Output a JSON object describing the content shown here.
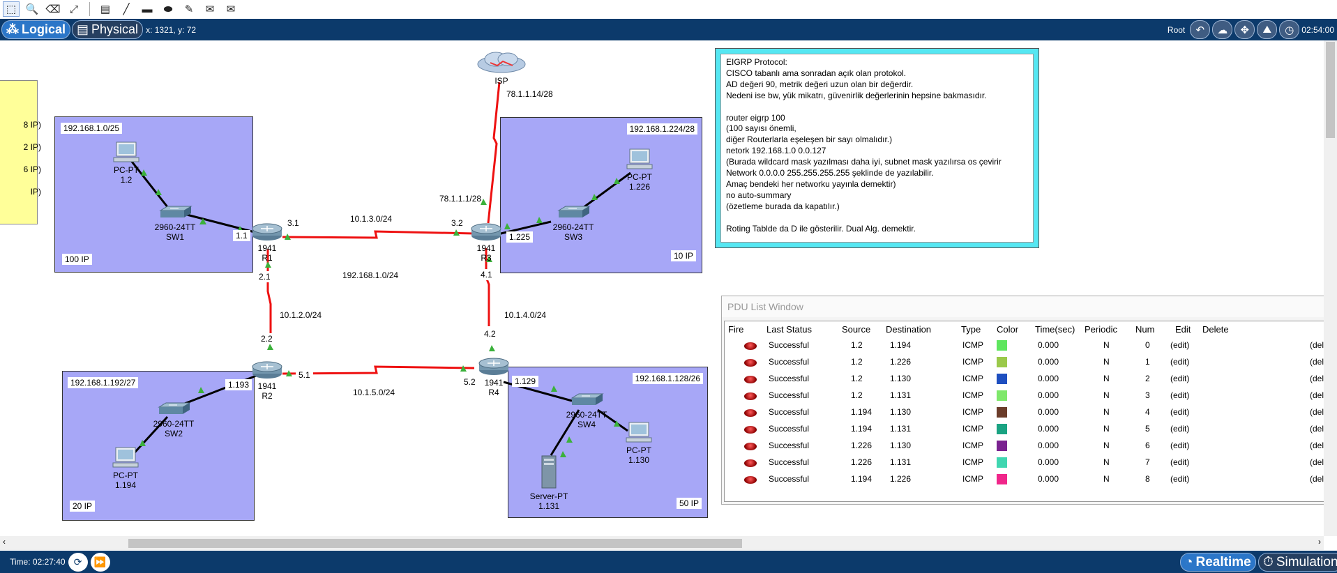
{
  "toolbar": {
    "icons": [
      "select-icon",
      "inspect-icon",
      "delete-icon",
      "resize-icon",
      "note-icon",
      "line-icon",
      "rectangle-icon",
      "ellipse-icon",
      "freeform-icon",
      "add-simple-pdu-icon",
      "add-complex-pdu-icon"
    ]
  },
  "topbar": {
    "logical_label": "Logical",
    "physical_label": "Physical",
    "coords": "x: 1321, y: 72",
    "root_label": "Root",
    "clock": "02:54:00"
  },
  "yellow_note": {
    "lines": [
      "8 IP)",
      "2 IP)",
      "6 IP)",
      "IP)"
    ]
  },
  "areas": {
    "sw1": {
      "subnet": "192.168.1.0/25",
      "size": "100 IP"
    },
    "sw3": {
      "subnet": "192.168.1.224/28",
      "size": "10 IP"
    },
    "sw2": {
      "subnet": "192.168.1.192/27",
      "size": "20 IP"
    },
    "sw4": {
      "subnet": "192.168.1.128/26",
      "size": "50 IP"
    }
  },
  "devices": {
    "isp": {
      "name": "ISP"
    },
    "r1": {
      "model": "1941",
      "name": "R1"
    },
    "r2": {
      "model": "1941",
      "name": "R2"
    },
    "r3": {
      "model": "1941",
      "name": "R3"
    },
    "r4": {
      "model": "1941",
      "name": "R4"
    },
    "sw1": {
      "model": "2960-24TT",
      "name": "SW1"
    },
    "sw2": {
      "model": "2960-24TT",
      "name": "SW2"
    },
    "sw3": {
      "model": "2960-24TT",
      "name": "SW3"
    },
    "sw4": {
      "model": "2960-24TT",
      "name": "SW4"
    },
    "pc1": {
      "type": "PC-PT",
      "addr": "1.2"
    },
    "pc2": {
      "type": "PC-PT",
      "addr": "1.194"
    },
    "pc3": {
      "type": "PC-PT",
      "addr": "1.226"
    },
    "pc4": {
      "type": "PC-PT",
      "addr": "1.130"
    },
    "server": {
      "type": "Server-PT",
      "addr": "1.131"
    }
  },
  "links": {
    "isp_r3_net": "78.1.1.14/28",
    "r3_isp_addr": "78.1.1.1/28",
    "r1_r3_net": "10.1.3.0/24",
    "r1_r2_net": "10.1.2.0/24",
    "r3_r4_net": "10.1.4.0/24",
    "r2_r4_net": "10.1.5.0/24",
    "lan_net": "192.168.1.0/24",
    "r1_sw1": "1.1",
    "r1_r3": "3.1",
    "r1_r2": "2.1",
    "r2_r1": "2.2",
    "r2_sw2": "1.193",
    "r2_r4": "5.1",
    "r3_r1": "3.2",
    "r3_sw3": "1.225",
    "r3_r4": "4.1",
    "r4_r3": "4.2",
    "r4_r2": "5.2",
    "r4_sw4": "1.129"
  },
  "eigrp_note": {
    "text": "EIGRP Protocol:\nCISCO tabanlı ama sonradan açık olan protokol.\nAD değeri 90, metrik değeri uzun olan bir değerdir.\nNedeni ise bw, yük mikatrı, güvenirlik değerlerinin hepsine bakmasıdır.\n\nrouter eigrp 100\n(100 sayısı önemli,\ndiğer Routerlarla eşeleşen bir sayı olmalıdır.)\nnetork 192.168.1.0 0.0.127\n(Burada wildcard mask yazılması daha iyi, subnet mask yazılırsa os çevirir\nNetwork 0.0.0.0 255.255.255.255 şeklinde de yazılabilir.\nAmaç bendeki her networku yayınla demektir)\nno auto-summary\n(özetleme burada da kapatılır.)\n\nRoting Tablde da D ile gösterilir. Dual Alg. demektir."
  },
  "pdu": {
    "title": "PDU List Window",
    "headers": [
      "Fire",
      "Last Status",
      "Source",
      "Destination",
      "Type",
      "Color",
      "Time(sec)",
      "Periodic",
      "Num",
      "Edit",
      "Delete"
    ],
    "rows": [
      {
        "status": "Successful",
        "source": "1.2",
        "dest": "1.194",
        "type": "ICMP",
        "color": "#5ee65e",
        "time": "0.000",
        "periodic": "N",
        "num": "0",
        "edit": "(edit)",
        "delete": "(delete)"
      },
      {
        "status": "Successful",
        "source": "1.2",
        "dest": "1.226",
        "type": "ICMP",
        "color": "#9bc94a",
        "time": "0.000",
        "periodic": "N",
        "num": "1",
        "edit": "(edit)",
        "delete": "(delete)"
      },
      {
        "status": "Successful",
        "source": "1.2",
        "dest": "1.130",
        "type": "ICMP",
        "color": "#1e4fc0",
        "time": "0.000",
        "periodic": "N",
        "num": "2",
        "edit": "(edit)",
        "delete": "(delete)"
      },
      {
        "status": "Successful",
        "source": "1.2",
        "dest": "1.131",
        "type": "ICMP",
        "color": "#7ee86a",
        "time": "0.000",
        "periodic": "N",
        "num": "3",
        "edit": "(edit)",
        "delete": "(delete)"
      },
      {
        "status": "Successful",
        "source": "1.194",
        "dest": "1.130",
        "type": "ICMP",
        "color": "#6b3c2a",
        "time": "0.000",
        "periodic": "N",
        "num": "4",
        "edit": "(edit)",
        "delete": "(delete)"
      },
      {
        "status": "Successful",
        "source": "1.194",
        "dest": "1.131",
        "type": "ICMP",
        "color": "#1aa382",
        "time": "0.000",
        "periodic": "N",
        "num": "5",
        "edit": "(edit)",
        "delete": "(delete)"
      },
      {
        "status": "Successful",
        "source": "1.226",
        "dest": "1.130",
        "type": "ICMP",
        "color": "#7a2290",
        "time": "0.000",
        "periodic": "N",
        "num": "6",
        "edit": "(edit)",
        "delete": "(delete)"
      },
      {
        "status": "Successful",
        "source": "1.226",
        "dest": "1.131",
        "type": "ICMP",
        "color": "#3fd6b0",
        "time": "0.000",
        "periodic": "N",
        "num": "7",
        "edit": "(edit)",
        "delete": "(delete)"
      },
      {
        "status": "Successful",
        "source": "1.194",
        "dest": "1.226",
        "type": "ICMP",
        "color": "#f0268a",
        "time": "0.000",
        "periodic": "N",
        "num": "8",
        "edit": "(edit)",
        "delete": "(delete)"
      }
    ]
  },
  "bottombar": {
    "time": "Time: 02:27:40",
    "realtime_label": "Realtime",
    "simulation_label": "Simulation"
  },
  "colors": {
    "link": "#ee1111",
    "area": "#a7a7f7",
    "topbar": "#0c3a6b",
    "note_border": "#55e7f2"
  }
}
